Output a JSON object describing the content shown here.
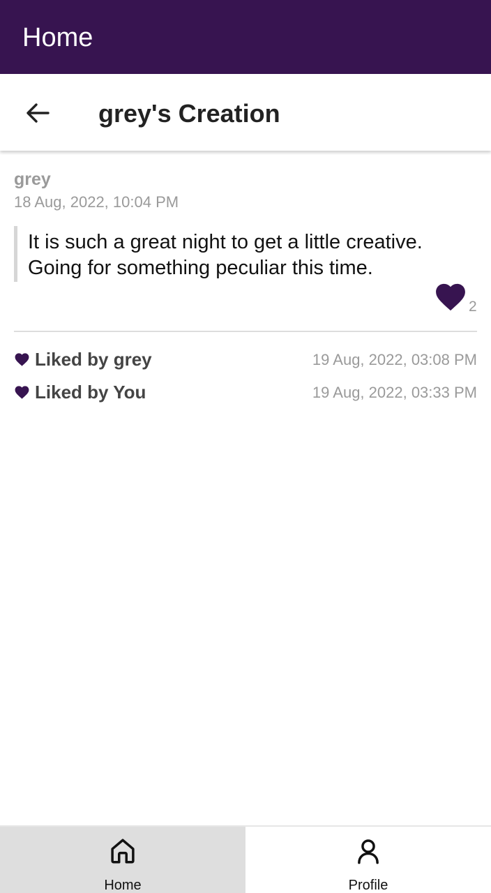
{
  "app_bar": {
    "title": "Home"
  },
  "sub_header": {
    "title": "grey's Creation",
    "back_icon": "arrow-back-icon"
  },
  "post": {
    "author": "grey",
    "date": "18 Aug, 2022, 10:04 PM",
    "text_lines": [
      "It is such a great night to get a little creative.",
      "Going for something peculiar this time."
    ],
    "like_count": "2",
    "like_icon": "heart-icon"
  },
  "likes": [
    {
      "label": "Liked by grey",
      "time": "19 Aug, 2022, 03:08 PM"
    },
    {
      "label": "Liked by You",
      "time": "19 Aug, 2022, 03:33 PM"
    }
  ],
  "bottom_nav": {
    "items": [
      {
        "label": "Home",
        "icon": "home-icon",
        "active": true
      },
      {
        "label": "Profile",
        "icon": "profile-icon",
        "active": false
      }
    ]
  },
  "colors": {
    "primary": "#371450",
    "nav_active_bg": "#dedede",
    "secondary_text": "#9a9a9a"
  }
}
